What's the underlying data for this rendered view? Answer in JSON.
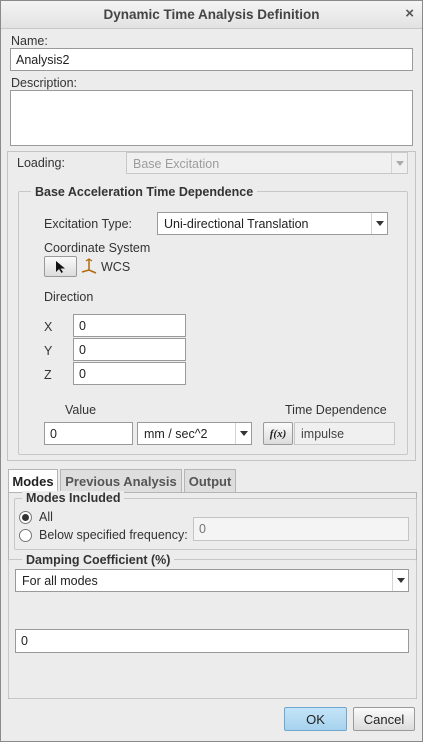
{
  "window": {
    "title": "Dynamic Time Analysis Definition",
    "close_glyph": "×"
  },
  "name": {
    "label": "Name:",
    "value": "Analysis2"
  },
  "description": {
    "label": "Description:",
    "value": ""
  },
  "loading": {
    "label": "Loading:",
    "value": "Base Excitation"
  },
  "base_accel": {
    "title": "Base Acceleration Time Dependence",
    "excitation_type": {
      "label": "Excitation Type:",
      "value": "Uni-directional Translation"
    },
    "coordinate_system": {
      "label": "Coordinate System",
      "value": "WCS"
    },
    "direction": {
      "label": "Direction",
      "x_label": "X",
      "x": "0",
      "y_label": "Y",
      "y": "0",
      "z_label": "Z",
      "z": "0"
    },
    "value": {
      "label": "Value",
      "value": "0",
      "units": "mm / sec^2"
    },
    "time_dependence": {
      "label": "Time Dependence",
      "fx": "f(x)",
      "value": "impulse"
    }
  },
  "tabs": [
    {
      "label": "Modes",
      "active": true
    },
    {
      "label": "Previous Analysis",
      "active": false
    },
    {
      "label": "Output",
      "active": false
    }
  ],
  "modes_included": {
    "title": "Modes Included",
    "all_label": "All",
    "below_label": "Below specified frequency:",
    "frequency_placeholder": "0",
    "selected": "All"
  },
  "damping": {
    "title": "Damping Coefficient (%)",
    "mode_option": "For all modes",
    "value": "0"
  },
  "buttons": {
    "ok": "OK",
    "cancel": "Cancel"
  },
  "colors": {
    "ok_button": "#a6d2ee",
    "dialog_bg": "#ececec"
  }
}
